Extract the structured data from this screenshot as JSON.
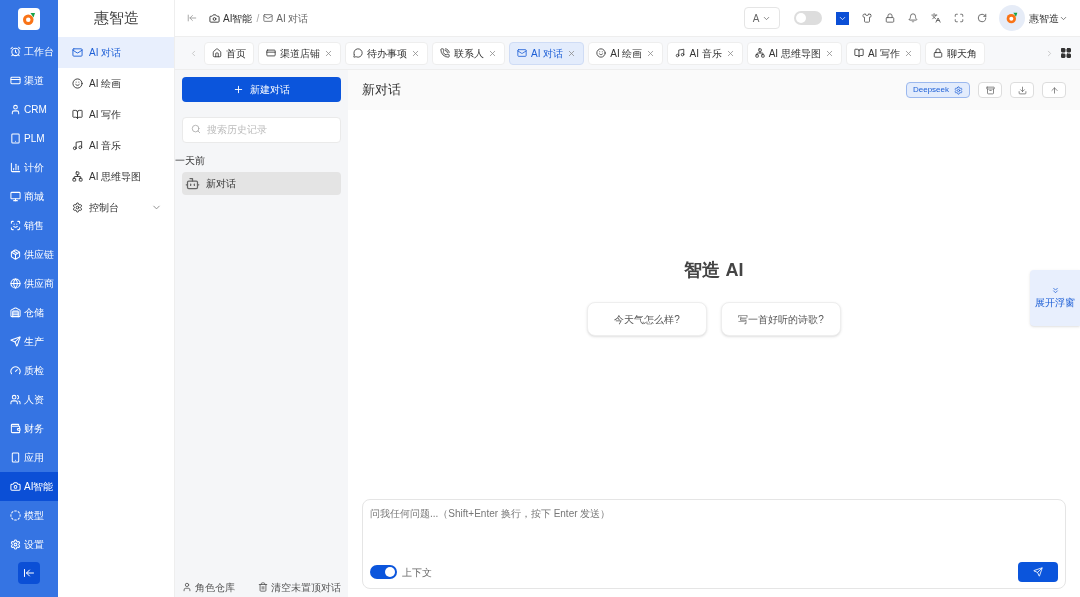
{
  "nav": {
    "items": [
      {
        "label": "工作台",
        "selected": false
      },
      {
        "label": "渠道",
        "selected": false
      },
      {
        "label": "CRM",
        "selected": false
      },
      {
        "label": "PLM",
        "selected": false
      },
      {
        "label": "计价",
        "selected": false
      },
      {
        "label": "商城",
        "selected": false
      },
      {
        "label": "销售",
        "selected": false
      },
      {
        "label": "供应链",
        "selected": false
      },
      {
        "label": "供应商",
        "selected": false
      },
      {
        "label": "仓储",
        "selected": false
      },
      {
        "label": "生产",
        "selected": false
      },
      {
        "label": "质检",
        "selected": false
      },
      {
        "label": "人资",
        "selected": false
      },
      {
        "label": "财务",
        "selected": false
      },
      {
        "label": "应用",
        "selected": false
      },
      {
        "label": "AI智能",
        "selected": true
      },
      {
        "label": "模型",
        "selected": false
      },
      {
        "label": "设置",
        "selected": false
      }
    ]
  },
  "submenu": {
    "title": "惠智造",
    "items": [
      {
        "label": "AI 对话",
        "selected": true,
        "expandable": false
      },
      {
        "label": "AI 绘画",
        "selected": false,
        "expandable": false
      },
      {
        "label": "AI 写作",
        "selected": false,
        "expandable": false
      },
      {
        "label": "AI 音乐",
        "selected": false,
        "expandable": false
      },
      {
        "label": "AI 思维导图",
        "selected": false,
        "expandable": false
      },
      {
        "label": "控制台",
        "selected": false,
        "expandable": true
      }
    ]
  },
  "breadcrumb": [
    "AI智能",
    "AI 对话"
  ],
  "breadcrumb_separator": "/",
  "header": {
    "font_button": "A",
    "dark_mode": false,
    "user": "惠智造"
  },
  "tabs": [
    {
      "label": "首页",
      "selected": false,
      "closable": false
    },
    {
      "label": "渠道店铺",
      "selected": false,
      "closable": true
    },
    {
      "label": "待办事项",
      "selected": false,
      "closable": true
    },
    {
      "label": "联系人",
      "selected": false,
      "closable": true
    },
    {
      "label": "AI 对话",
      "selected": true,
      "closable": true
    },
    {
      "label": "AI 绘画",
      "selected": false,
      "closable": true
    },
    {
      "label": "AI 音乐",
      "selected": false,
      "closable": true
    },
    {
      "label": "AI 思维导图",
      "selected": false,
      "closable": true
    },
    {
      "label": "AI 写作",
      "selected": false,
      "closable": true
    },
    {
      "label": "聊天角",
      "selected": false,
      "closable": false
    }
  ],
  "history": {
    "new_button": "新建对话",
    "search_placeholder": "搜索历史记录",
    "groups": [
      {
        "label": "一天前",
        "items": [
          {
            "title": "新对话",
            "selected": true
          }
        ]
      }
    ],
    "footer": [
      "角色仓库",
      "清空未置顶对话"
    ]
  },
  "chat": {
    "title": "新对话",
    "model": "Deepseek",
    "heading": "智造 AI",
    "suggestions": [
      "今天气怎么样?",
      "写一首好听的诗歌?"
    ],
    "float_button": "展开浮窗",
    "input_placeholder": "问我任何问题...（Shift+Enter 换行，按下 Enter 发送）",
    "context_label": "上下文",
    "context_on": true
  }
}
